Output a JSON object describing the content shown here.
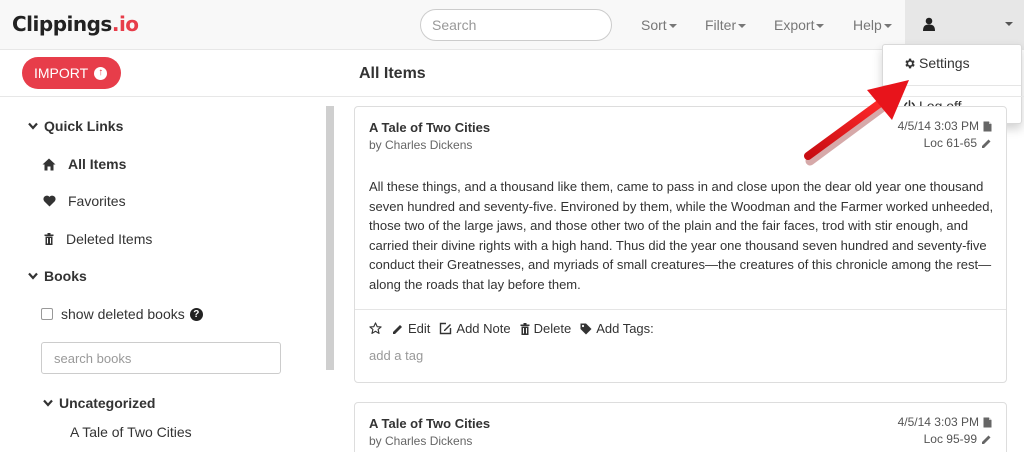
{
  "brand": {
    "name_main": "Clippings",
    "name_accent": ".io"
  },
  "navbar": {
    "search_placeholder": "Search",
    "sort_label": "Sort",
    "filter_label": "Filter",
    "export_label": "Export",
    "help_label": "Help",
    "user_icon": "user-icon"
  },
  "dropdown": {
    "settings_label": "Settings",
    "logoff_label": "Log off"
  },
  "sidebar": {
    "import_label": "IMPORT",
    "quick_links_heading": "Quick Links",
    "quick_links": [
      {
        "label": "All Items",
        "icon": "home-icon"
      },
      {
        "label": "Favorites",
        "icon": "heart-icon"
      },
      {
        "label": "Deleted Items",
        "icon": "trash-icon"
      }
    ],
    "books_heading": "Books",
    "show_deleted_label": "show deleted books",
    "show_deleted_checked": false,
    "book_search_placeholder": "search books",
    "category_heading": "Uncategorized",
    "books": [
      "A Tale of Two Cities"
    ]
  },
  "main": {
    "title": "All Items",
    "clippings": [
      {
        "title": "A Tale of Two Cities",
        "author": "by Charles Dickens",
        "date": "4/5/14 3:03 PM",
        "location": "Loc 61-65",
        "text": "All these things, and a thousand like them, came to pass in and close upon the dear old year one thousand seven hundred and seventy-five. Environed by them, while the Woodman and the Farmer worked unheeded, those two of the large jaws, and those other two of the plain and the fair faces, trod with stir enough, and carried their divine rights with a high hand. Thus did the year one thousand seven hundred and seventy-five conduct their Greatnesses, and myriads of small creatures—the creatures of this chronicle among the rest—along the roads that lay before them.",
        "actions": {
          "edit": "Edit",
          "add_note": "Add Note",
          "delete": "Delete",
          "add_tags": "Add Tags:"
        },
        "tag_placeholder": "add a tag"
      },
      {
        "title": "A Tale of Two Cities",
        "author": "by Charles Dickens",
        "date": "4/5/14 3:03 PM",
        "location": "Loc 95-99"
      }
    ]
  },
  "colors": {
    "accent": "#e73d4a",
    "arrow": "#e8141b",
    "navbar_bg": "#f8f8f8"
  }
}
